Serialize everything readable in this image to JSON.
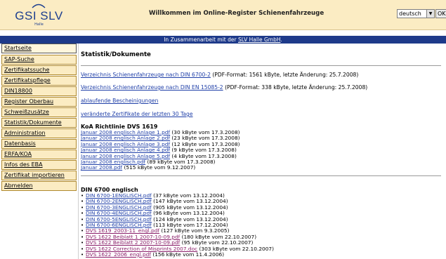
{
  "header": {
    "logo_text": "GSI SLV",
    "logo_sub": "Halle",
    "title": "Willkommen im Online-Register Schienenfahrzeuge",
    "language_selected": "deutsch",
    "ok_label": "OK"
  },
  "collab_bar": {
    "text": "In Zusammenarbeit mit der",
    "link": "SLV Halle GmbH",
    "suffix": "."
  },
  "sidebar": {
    "items": [
      {
        "label": "Startseite"
      },
      {
        "label": "SAP-Suche"
      },
      {
        "label": "Zertifikatssuche"
      },
      {
        "label": "Zertifikatspflege"
      },
      {
        "label": "DIN18800"
      },
      {
        "label": "Register Oberbau"
      },
      {
        "label": "Schweißzusätze"
      },
      {
        "label": "Statistik/Dokumente"
      },
      {
        "label": "Administration"
      },
      {
        "label": "Datenbasis"
      },
      {
        "label": "ERFA/KOA"
      },
      {
        "label": "Infos des EBA"
      },
      {
        "label": "Zertifikat importieren"
      },
      {
        "label": "Abmelden"
      }
    ]
  },
  "main": {
    "title": "Statistik/Dokumente",
    "docs": [
      {
        "link": "Verzeichnis Schienenfahrzeuge nach DIN 6700-2",
        "info": " (PDF-Format: 1561 kByte, letzte Änderung: 25.7.2008)"
      },
      {
        "link": "Verzeichnis Schienenfahrzeuge nach DIN EN 15085-2",
        "info": " (PDF-Format: 338 kByte, letzte Änderung: 25.7.2008)"
      },
      {
        "link": "ablaufende Bescheinigungen",
        "info": ""
      },
      {
        "link": "veränderte Zertifikate der letzten 30 Tage",
        "info": ""
      }
    ],
    "koa": {
      "title": "KoA Richtlinie DVS 1619",
      "files": [
        {
          "link": "Januar 2008 englisch Anlage 1.pdf",
          "info": " (30 kByte vom 17.3.2008)"
        },
        {
          "link": "Januar 2008 englisch Anlage 2.pdf",
          "info": " (23 kByte vom 17.3.2008)"
        },
        {
          "link": "Januar 2008 englisch Anlage 3.pdf",
          "info": " (12 kByte vom 17.3.2008)"
        },
        {
          "link": "Januar 2008 englisch Anlage 4.pdf",
          "info": " (9 kByte vom 17.3.2008)"
        },
        {
          "link": "Januar 2008 englisch Anlage 5.pdf",
          "info": " (4 kByte vom 17.3.2008)"
        },
        {
          "link": "Januar 2008 englisch.pdf",
          "info": " (89 kByte vom 17.3.2008)"
        },
        {
          "link": "Januar 2008.pdf",
          "info": " (515 kByte vom 9.12.2007)"
        }
      ]
    },
    "din6700": {
      "title": "DIN 6700 englisch",
      "files": [
        {
          "link": "DIN 6700-1ENGLISCH.pdf",
          "info": " (37 kByte vom 13.12.2004)"
        },
        {
          "link": "DIN 6700-2ENGLISCH.pdf",
          "info": " (147 kByte vom 13.12.2004)"
        },
        {
          "link": "DIN 6700-3ENGLISCH.pdf",
          "info": " (905 kByte vom 13.12.2004)"
        },
        {
          "link": "DIN 6700-4ENGLISCH.pdf",
          "info": " (96 kByte vom 13.12.2004)"
        },
        {
          "link": "DIN 6700-5ENGLISCH.pdf",
          "info": " (124 kByte vom 13.12.2004)"
        },
        {
          "link": "DIN 6700-6ENGLISCH.pdf",
          "info": " (113 kByte vom 17.12.2004)"
        },
        {
          "link": "DVS 1619_2003-11_engl.pdf",
          "info": " (127 kByte vom 9.3.2005)"
        },
        {
          "link": "DVS 1622 Beiblatt 1 2007-10-09.pdf",
          "info": " (180 kByte vom 22.10.2007)"
        },
        {
          "link": "DVS 1622 Beiblatt 2 2007-10-09.pdf",
          "info": " (95 kByte vom 22.10.2007)"
        },
        {
          "link": "DVS 1622 Correction of Misprints 2007.doc",
          "info": " (303 kByte vom 22.10.2007)"
        },
        {
          "link": "DVS 1622_2006_engl.pdf",
          "info": " (156 kByte vom 11.4.2006)"
        }
      ]
    }
  },
  "colors": {
    "header_bg": "#fbecc3",
    "bar_bg": "#1e3a8a",
    "link": "#1f3fa8",
    "visited_link": "#8a1f6a"
  }
}
